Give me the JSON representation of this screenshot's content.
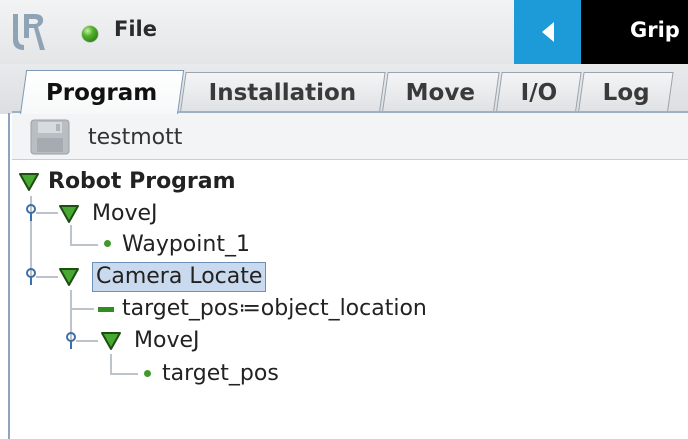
{
  "toolbar": {
    "file_label": "File",
    "title_partial": "Grip",
    "brand_color": "#1d9bd8",
    "status_color": "#52b22a"
  },
  "tabs": [
    {
      "label": "Program",
      "active": true
    },
    {
      "label": "Installation",
      "active": false
    },
    {
      "label": "Move",
      "active": false
    },
    {
      "label": "I/O",
      "active": false
    },
    {
      "label": "Log",
      "active": false
    }
  ],
  "program": {
    "name": "testmott"
  },
  "tree": {
    "root": "Robot Program",
    "movej_1": "MoveJ",
    "waypoint_1": "Waypoint_1",
    "camera_locate": "Camera Locate",
    "assignment": "target_pos≔object_location",
    "movej_2": "MoveJ",
    "target_pos": "target_pos"
  }
}
